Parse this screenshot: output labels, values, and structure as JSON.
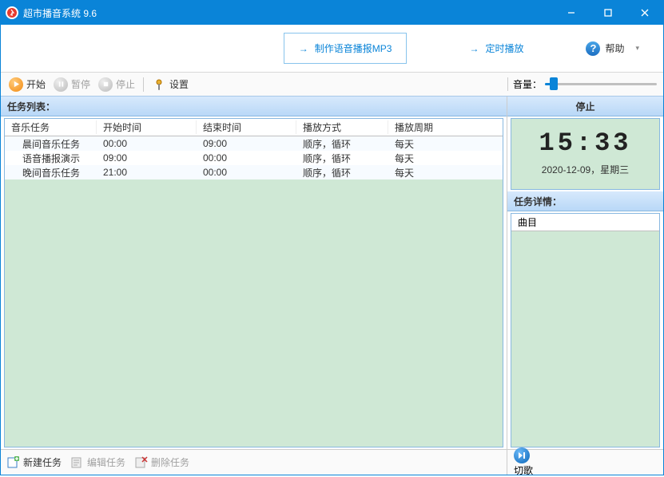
{
  "title": "超市播音系统 9.6",
  "topbar": {
    "make_mp3": "制作语音播报MP3",
    "schedule": "定时播放",
    "help": "帮助"
  },
  "subbar": {
    "start": "开始",
    "pause": "暂停",
    "stop": "停止",
    "settings": "设置",
    "volume_label": "音量：",
    "volume_percent": 8
  },
  "tasklist": {
    "header": "任务列表：",
    "columns": [
      "音乐任务",
      "开始时间",
      "结束时间",
      "播放方式",
      "播放周期"
    ],
    "rows": [
      {
        "name": "晨间音乐任务",
        "start": "00:00",
        "end": "09:00",
        "mode": "顺序，循环",
        "cycle": "每天"
      },
      {
        "name": "语音播报演示",
        "start": "09:00",
        "end": "00:00",
        "mode": "顺序，循环",
        "cycle": "每天"
      },
      {
        "name": "晚间音乐任务",
        "start": "21:00",
        "end": "00:00",
        "mode": "顺序，循环",
        "cycle": "每天"
      }
    ]
  },
  "bottombar": {
    "new": "新建任务",
    "edit": "编辑任务",
    "delete": "删除任务"
  },
  "status": {
    "state": "停止",
    "time": "15:33",
    "date": "2020-12-09，星期三"
  },
  "detail": {
    "header": "任务详情：",
    "track_label": "曲目"
  },
  "skip": "切歌"
}
